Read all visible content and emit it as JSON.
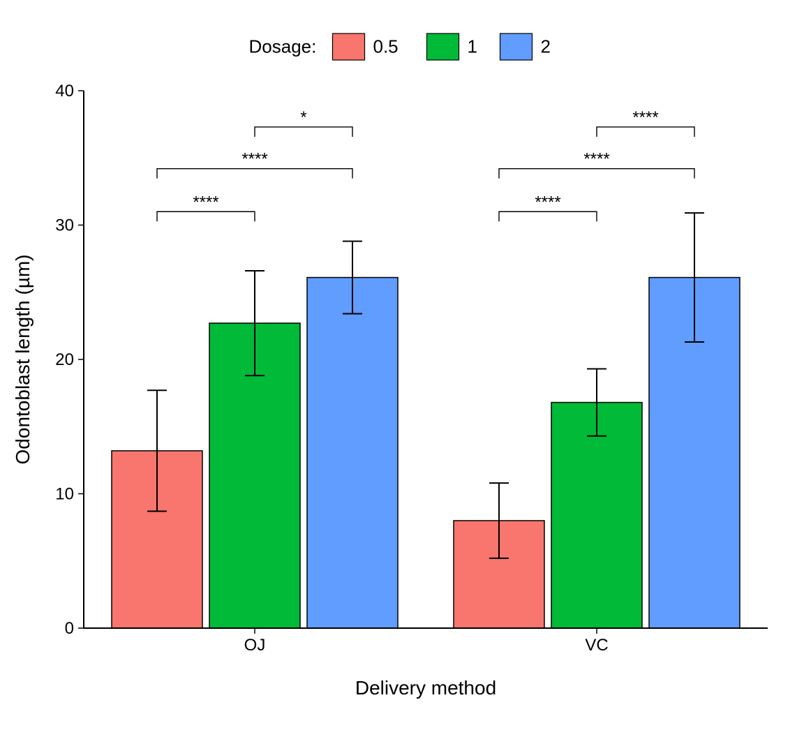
{
  "chart_data": {
    "type": "bar",
    "xlabel": "Delivery method",
    "ylabel": "Odontoblast length (µm)",
    "ylim": [
      0,
      40
    ],
    "yticks": [
      0,
      10,
      20,
      30,
      40
    ],
    "categories": [
      "OJ",
      "VC"
    ],
    "legend_title": "Dosage:",
    "series": [
      {
        "name": "0.5",
        "color": "#F8766D",
        "values": [
          13.2,
          8.0
        ],
        "err": [
          4.5,
          2.8
        ]
      },
      {
        "name": "1",
        "color": "#00BA38",
        "values": [
          22.7,
          16.8
        ],
        "err": [
          3.9,
          2.5
        ]
      },
      {
        "name": "2",
        "color": "#619CFF",
        "values": [
          26.1,
          26.1
        ],
        "err": [
          2.7,
          4.8
        ]
      }
    ],
    "significance": [
      {
        "group": 0,
        "from": 0,
        "to": 1,
        "y": 31.0,
        "label": "****"
      },
      {
        "group": 0,
        "from": 0,
        "to": 2,
        "y": 34.2,
        "label": "****"
      },
      {
        "group": 0,
        "from": 1,
        "to": 2,
        "y": 37.3,
        "label": "*"
      },
      {
        "group": 1,
        "from": 0,
        "to": 1,
        "y": 31.0,
        "label": "****"
      },
      {
        "group": 1,
        "from": 0,
        "to": 2,
        "y": 34.2,
        "label": "****"
      },
      {
        "group": 1,
        "from": 1,
        "to": 2,
        "y": 37.3,
        "label": "****"
      }
    ]
  }
}
